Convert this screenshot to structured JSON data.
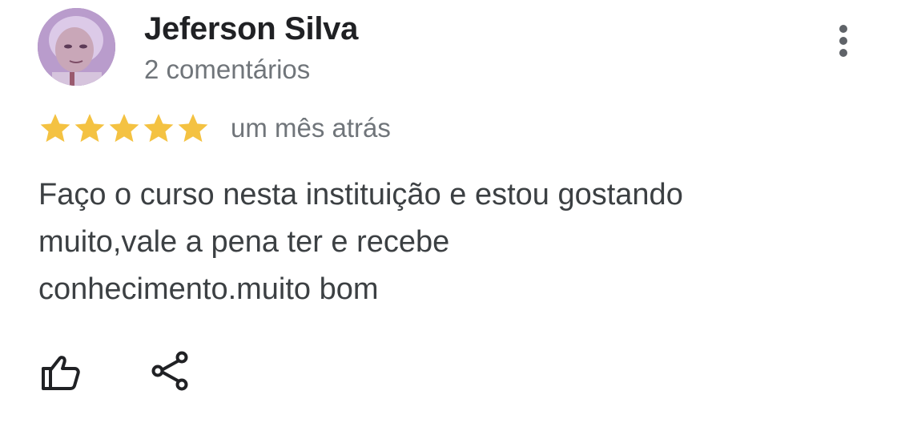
{
  "reviewer": {
    "name": "Jeferson Silva",
    "meta": "2 comentários",
    "avatar_icon": "profile-photo"
  },
  "review": {
    "rating": 5,
    "rating_max": 5,
    "star_color": "#f4c242",
    "date": "um mês atrás",
    "text_lines": [
      "Faço o curso nesta instituição e estou gostando",
      "muito,vale a pena ter e recebe",
      "conhecimento.muito bom"
    ]
  },
  "actions": {
    "more_icon": "more-vert-icon",
    "like_icon": "thumbs-up-icon",
    "share_icon": "share-icon"
  }
}
